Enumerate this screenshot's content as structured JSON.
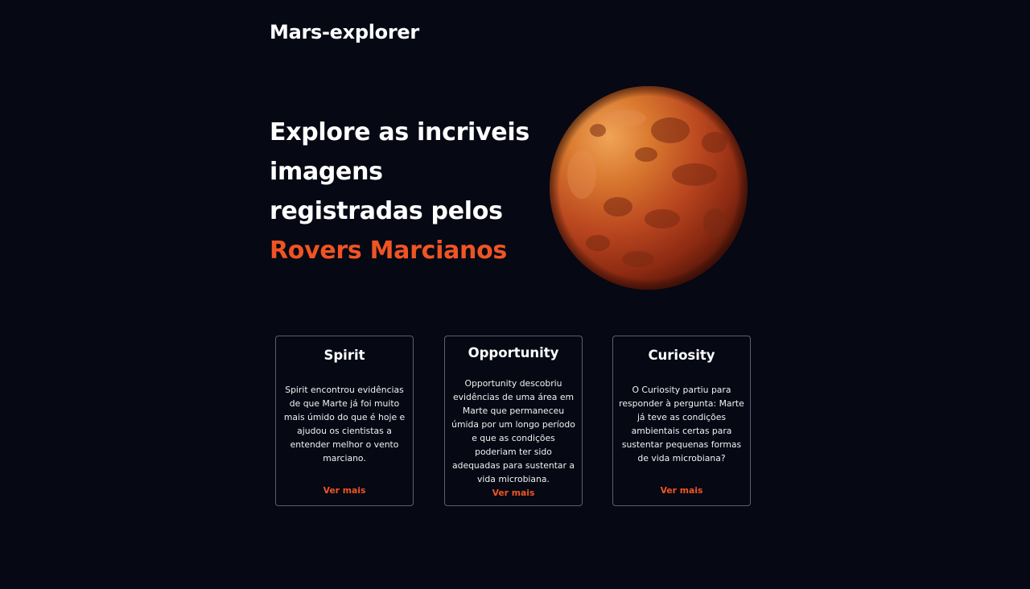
{
  "header": {
    "logo": "Mars-explorer"
  },
  "hero": {
    "title_lines": [
      "Explore as incriveis",
      "imagens",
      "registradas pelos"
    ],
    "title_accent": "Rovers Marcianos",
    "image_alt": "Planeta Marte"
  },
  "cards": [
    {
      "title": "Spirit",
      "text": "Spirit encontrou evidências de que Marte já foi muito mais úmido do que é hoje e ajudou os cientistas a entender melhor o vento marciano.",
      "link": "Ver mais"
    },
    {
      "title": "Opportunity",
      "text": "Opportunity descobriu evidências de uma área em Marte que permaneceu úmida por um longo período e que as condições poderiam ter sido adequadas para sustentar a vida microbiana.",
      "link": "Ver mais"
    },
    {
      "title": "Curiosity",
      "text": "O Curiosity partiu para responder à pergunta: Marte já teve as condições ambientais certas para sustentar pequenas formas de vida microbiana?",
      "link": "Ver mais"
    }
  ],
  "colors": {
    "background": "#060814",
    "accent": "#f05423",
    "card_border": "#5c5f6c"
  }
}
